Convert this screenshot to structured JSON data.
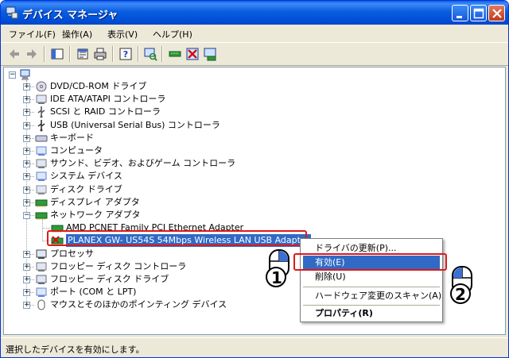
{
  "window": {
    "title": "デバイス マネージャ"
  },
  "menubar": {
    "items": [
      "ファイル(F)",
      "操作(A)",
      "表示(V)",
      "ヘルプ(H)"
    ]
  },
  "tree": {
    "root_label": "",
    "categories": [
      {
        "label": "DVD/CD-ROM ドライブ",
        "icon": "cdrom-icon"
      },
      {
        "label": "IDE ATA/ATAPI コントローラ",
        "icon": "ide-controller-icon"
      },
      {
        "label": "SCSI と RAID コントローラ",
        "icon": "scsi-icon"
      },
      {
        "label": "USB (Universal Serial Bus) コントローラ",
        "icon": "usb-icon"
      },
      {
        "label": "キーボード",
        "icon": "keyboard-icon"
      },
      {
        "label": "コンピュータ",
        "icon": "computer-icon"
      },
      {
        "label": "サウンド、ビデオ、およびゲーム コントローラ",
        "icon": "sound-icon"
      },
      {
        "label": "システム デバイス",
        "icon": "system-device-icon"
      },
      {
        "label": "ディスク ドライブ",
        "icon": "disk-drive-icon"
      },
      {
        "label": "ディスプレイ アダプタ",
        "icon": "display-adapter-icon"
      },
      {
        "label": "ネットワーク アダプタ",
        "icon": "network-adapter-icon"
      }
    ],
    "network_children": [
      {
        "label": "AMD PCNET Family PCI Ethernet Adapter"
      },
      {
        "label": "PLANEX GW- US54S 54Mbps Wireless LAN USB Adapter"
      }
    ],
    "categories_after": [
      {
        "label": "プロセッサ",
        "icon": "processor-icon"
      },
      {
        "label": "フロッピー ディスク コントローラ",
        "icon": "floppy-controller-icon"
      },
      {
        "label": "フロッピー ディスク ドライブ",
        "icon": "floppy-drive-icon"
      },
      {
        "label": "ポート (COM と LPT)",
        "icon": "port-icon"
      },
      {
        "label": "マウスとそのほかのポインティング デバイス",
        "icon": "mouse-icon"
      }
    ]
  },
  "context_menu": {
    "items": [
      "ドライバの更新(P)...",
      "有効(E)",
      "削除(U)",
      "ハードウェア変更のスキャン(A)",
      "プロパティ(R)"
    ]
  },
  "callouts": {
    "step1": "1",
    "step2": "2"
  },
  "status": {
    "text": "選択したデバイスを有効にします。"
  },
  "colors": {
    "titlebar": "#0a5de0",
    "selection": "#316ac5",
    "highlight_box": "#e01818"
  }
}
